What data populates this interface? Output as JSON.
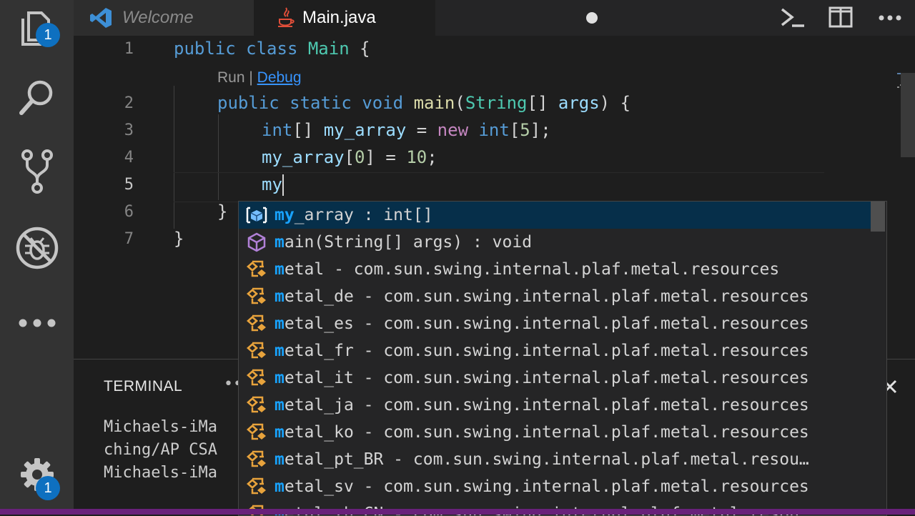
{
  "activity_bar": {
    "explorer_badge": "1",
    "settings_badge": "1"
  },
  "tabs": [
    {
      "label": "Welcome",
      "icon": "vscode-logo-icon"
    },
    {
      "label": "Main.java",
      "icon": "java-icon",
      "modified": true
    }
  ],
  "editor": {
    "line_numbers": [
      "1",
      "2",
      "3",
      "4",
      "5",
      "6",
      "7"
    ],
    "lines": {
      "l1": {
        "kw1": "public",
        "kw2": "class",
        "name": "Main",
        "brace": "{"
      },
      "l2": {
        "kw1": "public",
        "kw2": "static",
        "kw3": "void",
        "fn": "main",
        "paren_open": "(",
        "type": "String",
        "brackets": "[]",
        "arg": "args",
        "rest": ") {"
      },
      "l3": {
        "type": "int",
        "brackets": "[]",
        "var": "my_array",
        "eq": "=",
        "kw": "new",
        "type2": "int",
        "open": "[",
        "num": "5",
        "close": "];"
      },
      "l4": {
        "var": "my_array",
        "open": "[",
        "num0": "0",
        "close": "] =",
        "num": "10",
        "semi": ";"
      },
      "l5": {
        "text": "my"
      },
      "l6": {
        "text": "}"
      },
      "l7": {
        "text": "}"
      }
    },
    "codelens": {
      "run": "Run",
      "sep": " | ",
      "debug": "Debug"
    }
  },
  "panel": {
    "title": "TERMINAL",
    "more": "••",
    "lines": [
      "Michaels-iMa",
      "ching/AP CSA",
      "Michaels-iMa"
    ]
  },
  "suggestions": [
    {
      "match": "my",
      "rest": "_array : int[]",
      "icon": "variable-icon",
      "selected": true
    },
    {
      "match": "m",
      "rest": "ain(String[] args) : void",
      "icon": "method-icon"
    },
    {
      "match": "m",
      "rest": "etal - com.sun.swing.internal.plaf.metal.resources",
      "icon": "module-icon"
    },
    {
      "match": "m",
      "rest": "etal_de - com.sun.swing.internal.plaf.metal.resources",
      "icon": "module-icon"
    },
    {
      "match": "m",
      "rest": "etal_es - com.sun.swing.internal.plaf.metal.resources",
      "icon": "module-icon"
    },
    {
      "match": "m",
      "rest": "etal_fr - com.sun.swing.internal.plaf.metal.resources",
      "icon": "module-icon"
    },
    {
      "match": "m",
      "rest": "etal_it - com.sun.swing.internal.plaf.metal.resources",
      "icon": "module-icon"
    },
    {
      "match": "m",
      "rest": "etal_ja - com.sun.swing.internal.plaf.metal.resources",
      "icon": "module-icon"
    },
    {
      "match": "m",
      "rest": "etal_ko - com.sun.swing.internal.plaf.metal.resources",
      "icon": "module-icon"
    },
    {
      "match": "m",
      "rest": "etal_pt_BR - com.sun.swing.internal.plaf.metal.resou…",
      "icon": "module-icon"
    },
    {
      "match": "m",
      "rest": "etal_sv - com.sun.swing.internal.plaf.metal.resources",
      "icon": "module-icon"
    },
    {
      "match": "m",
      "rest": "etal_zh_CN - com.sun.swing.internal.plaf.metal.resou…",
      "icon": "module-icon"
    }
  ],
  "colors": {
    "accent": "#0e70c0",
    "selection": "#062f4a",
    "match": "#18a3ff",
    "status": "#68217a"
  }
}
